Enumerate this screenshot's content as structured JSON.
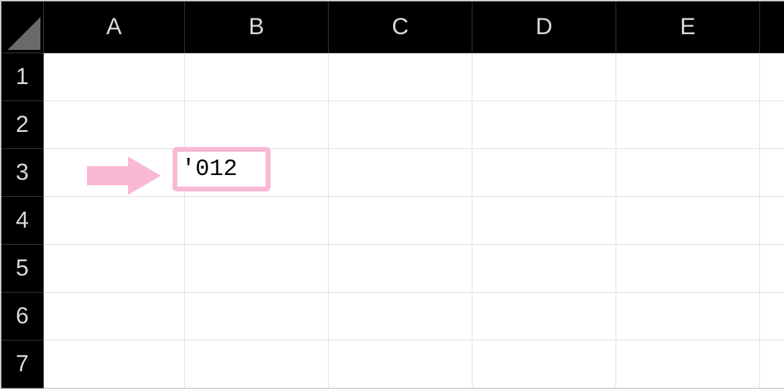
{
  "columns": [
    "A",
    "B",
    "C",
    "D",
    "E"
  ],
  "rows": [
    "1",
    "2",
    "3",
    "4",
    "5",
    "6",
    "7"
  ],
  "highlighted_cell": {
    "ref": "B3",
    "display_value": "'012"
  },
  "annotation": {
    "arrow_color": "#f9b8d3",
    "box_border_color": "#f9b8d3"
  }
}
